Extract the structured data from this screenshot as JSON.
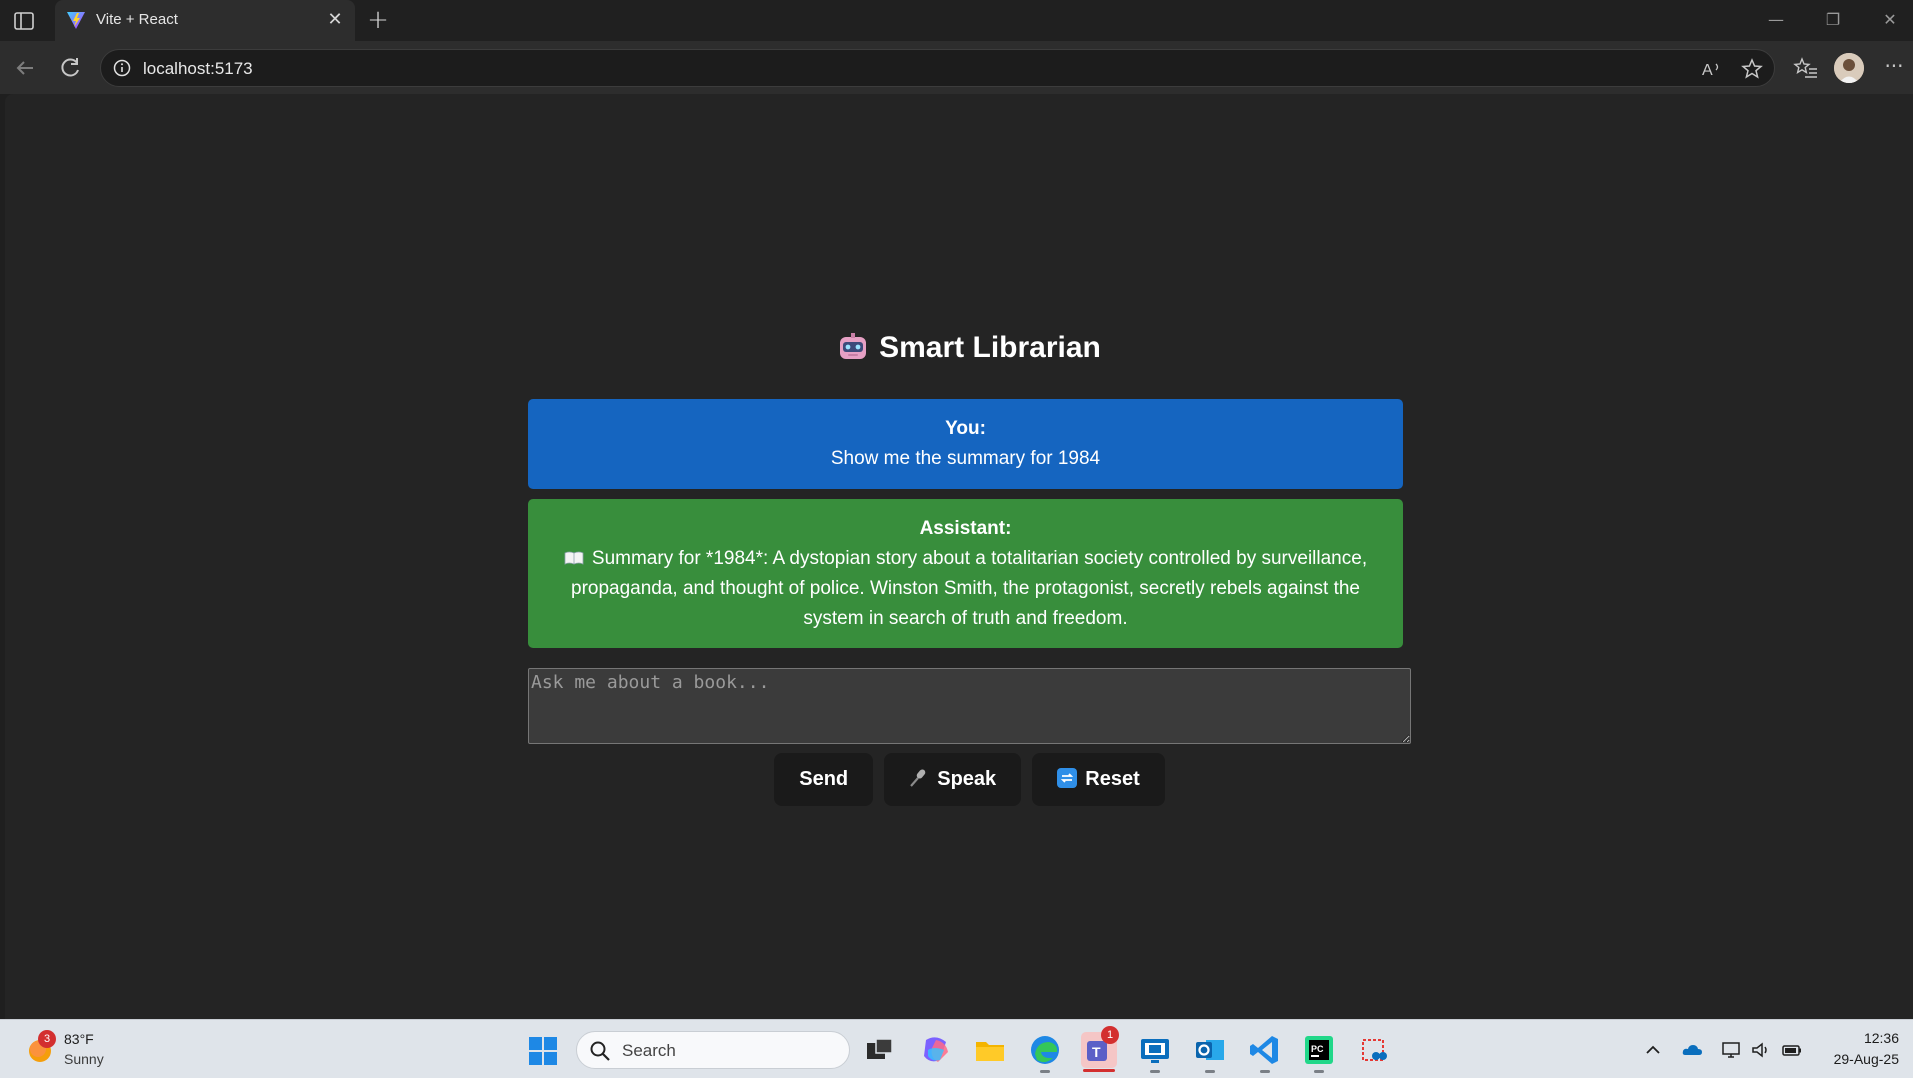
{
  "browser": {
    "tab": {
      "title": "Vite + React",
      "close_glyph": "✕"
    },
    "new_tab_glyph": "+",
    "url": "localhost:5173",
    "window_controls": {
      "minimize": "—",
      "restore": "❐",
      "close": "✕"
    },
    "more_glyph": "···"
  },
  "app": {
    "title": "Smart Librarian",
    "messages": [
      {
        "role_label": "You:",
        "text": "Show me the summary for 1984",
        "color": "#1565c0"
      },
      {
        "role_label": "Assistant:",
        "text": "Summary for *1984*: A dystopian story about a totalitarian society controlled by surveillance, propaganda, and thought of police. Winston Smith, the protagonist, secretly rebels against the system in search of truth and freedom.",
        "icon": "book-icon",
        "color": "#388e3c"
      }
    ],
    "input": {
      "placeholder": "Ask me about a book...",
      "value": ""
    },
    "buttons": {
      "send": "Send",
      "speak": "Speak",
      "reset": "Reset"
    }
  },
  "taskbar": {
    "weather": {
      "temp": "83°F",
      "condition": "Sunny",
      "badge": "3"
    },
    "search_placeholder": "Search",
    "teams_badge": "1",
    "clock": {
      "time": "12:36",
      "date": "29-Aug-25"
    }
  }
}
